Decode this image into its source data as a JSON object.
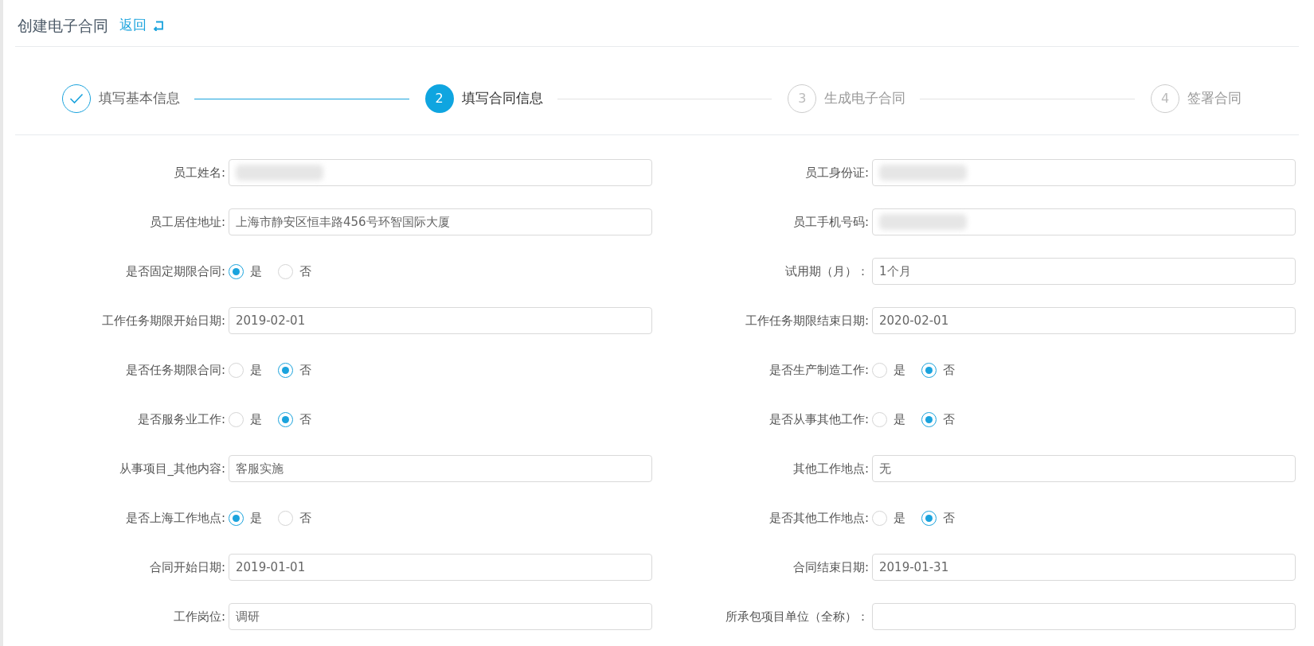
{
  "header": {
    "title": "创建电子合同",
    "back_link": "返回"
  },
  "steps": [
    {
      "kind": "done",
      "label": "填写基本信息"
    },
    {
      "kind": "active",
      "number": "2",
      "label": "填写合同信息"
    },
    {
      "kind": "pending",
      "number": "3",
      "label": "生成电子合同"
    },
    {
      "kind": "pending",
      "number": "4",
      "label": "签署合同"
    }
  ],
  "fields": [
    {
      "kind": "text",
      "label": "员工姓名:",
      "redacted": true
    },
    {
      "kind": "text",
      "label": "员工身份证:",
      "redacted": true
    },
    {
      "kind": "text",
      "label": "员工居住地址:",
      "value": "上海市静安区恒丰路456号环智国际大厦"
    },
    {
      "kind": "text",
      "label": "员工手机号码:",
      "redacted": true
    },
    {
      "kind": "radio",
      "label": "是否固定期限合同:",
      "options": [
        {
          "label": "是",
          "selected": true
        },
        {
          "label": "否",
          "selected": false
        }
      ]
    },
    {
      "kind": "text",
      "label": "试用期（月）：",
      "value": "1个月"
    },
    {
      "kind": "text",
      "label": "工作任务期限开始日期:",
      "value": "2019-02-01"
    },
    {
      "kind": "text",
      "label": "工作任务期限结束日期:",
      "value": "2020-02-01"
    },
    {
      "kind": "radio",
      "label": "是否任务期限合同:",
      "options": [
        {
          "label": "是",
          "selected": false
        },
        {
          "label": "否",
          "selected": true
        }
      ]
    },
    {
      "kind": "radio",
      "label": "是否生产制造工作:",
      "options": [
        {
          "label": "是",
          "selected": false
        },
        {
          "label": "否",
          "selected": true
        }
      ]
    },
    {
      "kind": "radio",
      "label": "是否服务业工作:",
      "options": [
        {
          "label": "是",
          "selected": false
        },
        {
          "label": "否",
          "selected": true
        }
      ]
    },
    {
      "kind": "radio",
      "label": "是否从事其他工作:",
      "options": [
        {
          "label": "是",
          "selected": false
        },
        {
          "label": "否",
          "selected": true
        }
      ]
    },
    {
      "kind": "text",
      "label": "从事项目_其他内容:",
      "value": "客服实施"
    },
    {
      "kind": "text",
      "label": "其他工作地点:",
      "value": "无"
    },
    {
      "kind": "radio",
      "label": "是否上海工作地点:",
      "options": [
        {
          "label": "是",
          "selected": true
        },
        {
          "label": "否",
          "selected": false
        }
      ]
    },
    {
      "kind": "radio",
      "label": "是否其他工作地点:",
      "options": [
        {
          "label": "是",
          "selected": false
        },
        {
          "label": "否",
          "selected": true
        }
      ]
    },
    {
      "kind": "text",
      "label": "合同开始日期:",
      "value": "2019-01-01"
    },
    {
      "kind": "text",
      "label": "合同结束日期:",
      "value": "2019-01-31"
    },
    {
      "kind": "text",
      "label": "工作岗位:",
      "value": "调研"
    },
    {
      "kind": "text",
      "label": "所承包项目单位（全称）："
    }
  ]
}
